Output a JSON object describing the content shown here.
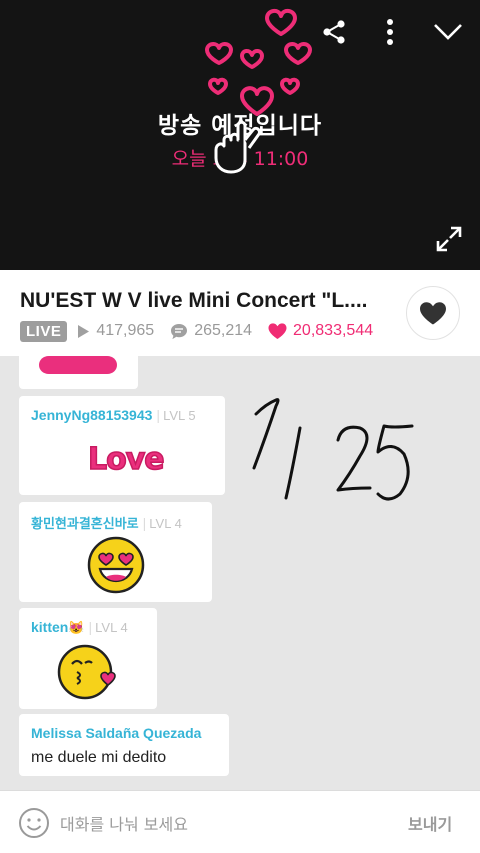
{
  "player": {
    "broadcast_title": "방송 예정입니다",
    "broadcast_time": "오늘 오후 11:00",
    "icons": {
      "share": "share-icon",
      "more": "more-vertical-icon",
      "collapse": "chevron-down-icon",
      "fullscreen": "expand-icon",
      "hand": "finger-heart-icon"
    }
  },
  "video": {
    "title": "NU'EST W V live Mini Concert \"L....",
    "live_badge": "LIVE",
    "plays": "417,965",
    "comments": "265,214",
    "likes": "20,833,544"
  },
  "chat": {
    "messages": [
      {
        "username": "",
        "level": "",
        "sticker": "love-sticker"
      },
      {
        "username": "JennyNg88153943",
        "level": "LVL 5",
        "sticker": "love-sticker",
        "sticker_text": "Love"
      },
      {
        "username": "황민현과결혼신바로",
        "level": "LVL 4",
        "sticker": "heart-eyes-emoji"
      },
      {
        "username": "kitten",
        "username_emoji": "😻",
        "level": "LVL 4",
        "sticker": "kissing-emoji"
      },
      {
        "username": "Melissa Saldaña Quezada",
        "level": "",
        "text": "me duele mi dedito"
      }
    ],
    "handwriting_note": "7/25"
  },
  "input": {
    "placeholder": "대화를 나눠 보세요",
    "send_label": "보내기"
  },
  "colors": {
    "accent_pink": "#f02c74",
    "username_blue": "#36b4d6",
    "player_bg": "#141414"
  }
}
